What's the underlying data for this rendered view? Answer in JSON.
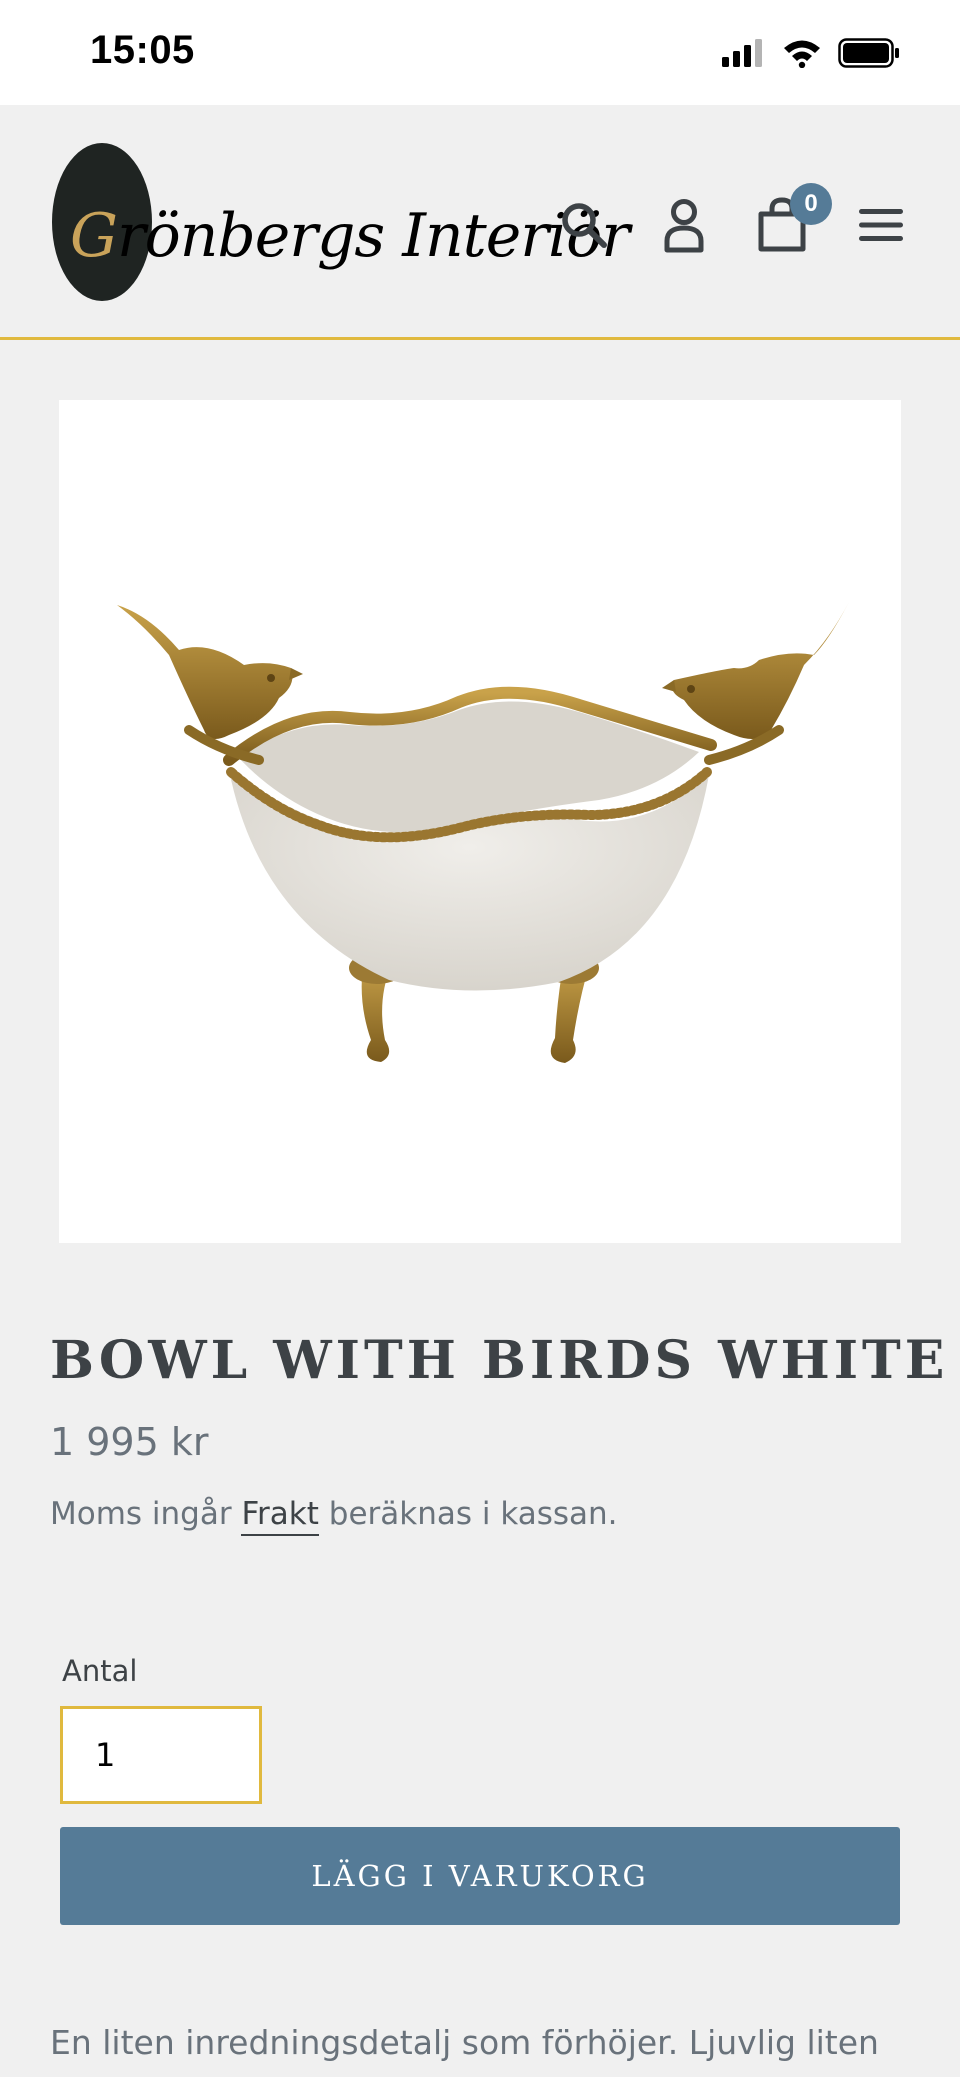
{
  "status_bar": {
    "time": "15:05"
  },
  "header": {
    "logo_initial": "G",
    "logo_rest": "rönbergs Interiör",
    "cart_count": "0"
  },
  "product": {
    "title": "BOWL WITH BIRDS WHITE",
    "price": "1 995 kr",
    "tax_prefix": "Moms ingår",
    "shipping_link": "Frakt",
    "tax_suffix": "beräknas i kassan.",
    "quantity_label": "Antal",
    "quantity_value": "1",
    "add_to_cart_label": "LÄGG I VARUKORG",
    "description": "En liten inredningsdetalj som förhöjer. Ljuvlig liten"
  },
  "colors": {
    "accent_gold": "#e0b93e",
    "button_blue": "#557b97",
    "background": "#f0f0f0",
    "bronze": "#a07c32"
  }
}
